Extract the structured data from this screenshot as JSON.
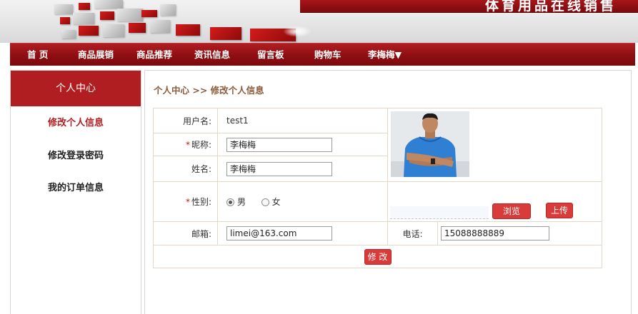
{
  "header": {
    "site_title": "体育用品在线销售"
  },
  "nav": {
    "items": [
      "首 页",
      "商品展销",
      "商品推荐",
      "资讯信息",
      "留言板",
      "购物车",
      "李梅梅▼"
    ]
  },
  "sidebar": {
    "title": "个人中心",
    "items": [
      {
        "label": "修改个人信息",
        "active": true
      },
      {
        "label": "修改登录密码",
        "active": false
      },
      {
        "label": "我的订单信息",
        "active": false
      }
    ]
  },
  "main": {
    "breadcrumb": "个人中心 >> 修改个人信息",
    "form": {
      "username_label": "用户名:",
      "username_value": "test1",
      "required_mark": "*",
      "nickname_label": "昵称:",
      "nickname_value": "李梅梅",
      "realname_label": "姓名:",
      "realname_value": "李梅梅",
      "gender_label": "性别:",
      "gender_male": "男",
      "gender_female": "女",
      "gender_selected": "男",
      "email_label": "邮箱:",
      "email_value": "limei@163.com",
      "phone_label": "电话:",
      "phone_value": "15088888889",
      "browse_button": "浏览",
      "upload_button": "上传",
      "submit_button": "修 改"
    }
  },
  "colors": {
    "brand_red": "#b01e22",
    "button_red": "#d93a3a",
    "upload_bg": "#ddeaf8",
    "breadcrumb": "#8a5a3a"
  }
}
